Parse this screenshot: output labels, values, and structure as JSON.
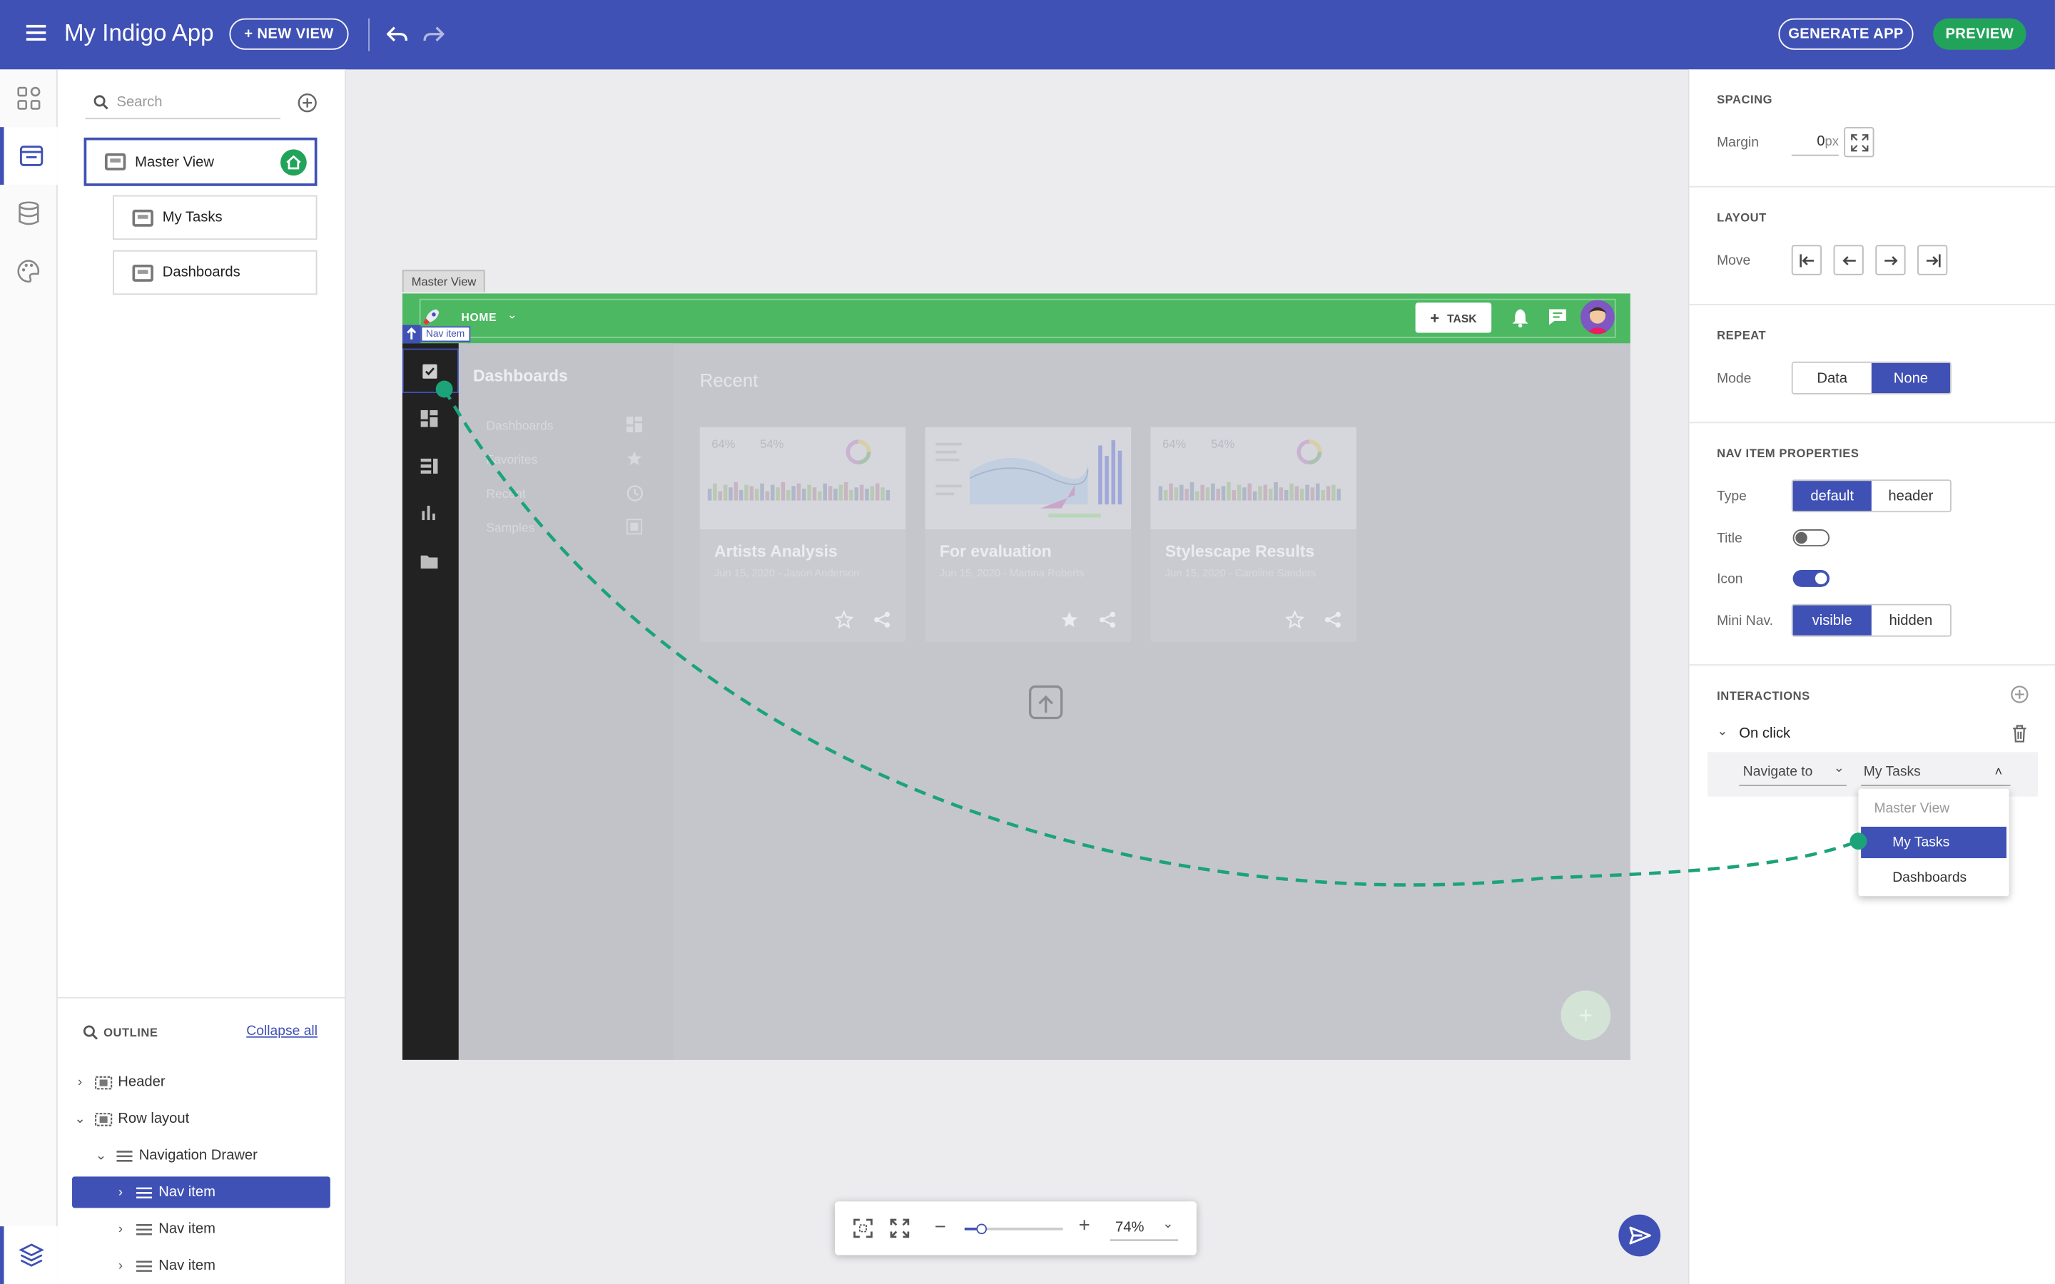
{
  "app": {
    "title": "My Indigo App"
  },
  "topbar": {
    "new_view": "+ NEW VIEW",
    "generate_app": "GENERATE APP",
    "preview": "PREVIEW",
    "colors": {
      "bar": "#3f51b5",
      "preview": "#22a35a"
    }
  },
  "left_panel": {
    "search_placeholder": "Search",
    "views": [
      {
        "label": "Master View",
        "home": true
      },
      {
        "label": "My Tasks"
      },
      {
        "label": "Dashboards"
      }
    ]
  },
  "outline": {
    "title": "OUTLINE",
    "collapse_all": "Collapse all",
    "items": [
      {
        "label": "Header",
        "expanded": false
      },
      {
        "label": "Row layout",
        "expanded": true
      },
      {
        "label": "Navigation Drawer",
        "expanded": true
      },
      {
        "label": "Nav item",
        "selected": true
      },
      {
        "label": "Nav item"
      },
      {
        "label": "Nav item"
      }
    ]
  },
  "canvas": {
    "view_tab": "Master View",
    "nav_tooltip": "Nav item",
    "header": {
      "home_label": "HOME",
      "task_button": "TASK",
      "color": "#4cb862"
    },
    "drawer": {
      "title": "Dashboards",
      "items": [
        "Dashboards",
        "Favorites",
        "Recent",
        "Samples"
      ]
    },
    "recent_title": "Recent",
    "cards": [
      {
        "title": "Artists Analysis",
        "subtitle": "Jun 15, 2020 - Jason Anderson",
        "stat1": "64%",
        "stat2": "54%"
      },
      {
        "title": "For evaluation",
        "subtitle": "Jun 15, 2020 - Martina Roberts",
        "stat1": "",
        "stat2": ""
      },
      {
        "title": "Stylescape Results",
        "subtitle": "Jun 15, 2020 - Caroline Sanders",
        "stat1": "64%",
        "stat2": "54%"
      }
    ]
  },
  "zoom": {
    "value": "74%",
    "slider_fraction": 0.17
  },
  "properties": {
    "spacing": {
      "title": "SPACING",
      "margin_label": "Margin",
      "margin_value": "0",
      "margin_unit": "px"
    },
    "layout": {
      "title": "LAYOUT",
      "move_label": "Move"
    },
    "repeat": {
      "title": "REPEAT",
      "mode_label": "Mode",
      "options": [
        "Data",
        "None"
      ],
      "selected": "None"
    },
    "nav_item": {
      "title": "NAV ITEM PROPERTIES",
      "type_label": "Type",
      "type_options": [
        "default",
        "header"
      ],
      "type_selected": "default",
      "title_label": "Title",
      "title_toggle": false,
      "icon_label": "Icon",
      "icon_toggle": true,
      "mini_nav_label": "Mini Nav.",
      "mini_nav_options": [
        "visible",
        "hidden"
      ],
      "mini_nav_selected": "visible"
    },
    "interactions": {
      "title": "INTERACTIONS",
      "event": "On click",
      "action": "Navigate to",
      "target": "My Tasks",
      "dropdown_options": [
        "Master View",
        "My Tasks",
        "Dashboards"
      ],
      "dropdown_selected": "My Tasks"
    }
  }
}
